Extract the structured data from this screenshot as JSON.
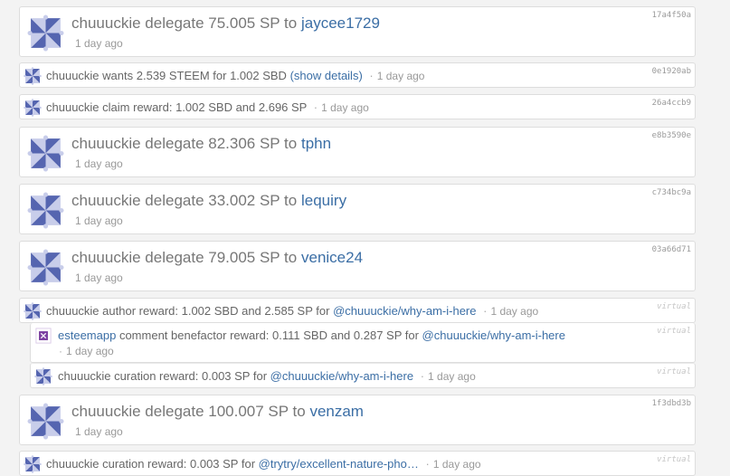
{
  "operations": [
    {
      "user": "chuuuckie",
      "text": "delegate 75.005 SP to",
      "link": "jaycee1729",
      "hash": "17a4f50a",
      "ago": "1 day ago"
    },
    {
      "user": "chuuuckie",
      "text": "wants 2.539 STEEM for 1.002 SBD",
      "link": "(show details)",
      "hash": "0e1920ab",
      "ago": "1 day ago"
    },
    {
      "user": "chuuuckie",
      "text": "claim reward: 1.002 SBD and 2.696 SP",
      "hash": "26a4ccb9",
      "ago": "1 day ago"
    },
    {
      "user": "chuuuckie",
      "text": "delegate 82.306 SP to",
      "link": "tphn",
      "hash": "e8b3590e",
      "ago": "1 day ago"
    },
    {
      "user": "chuuuckie",
      "text": "delegate 33.002 SP to",
      "link": "lequiry",
      "hash": "c734bc9a",
      "ago": "1 day ago"
    },
    {
      "user": "chuuuckie",
      "text": "delegate 79.005 SP to",
      "link": "venice24",
      "hash": "03a66d71",
      "ago": "1 day ago"
    },
    {
      "user": "chuuuckie",
      "text": "author reward: 1.002 SBD and 2.585 SP for",
      "link": "@chuuuckie/why-am-i-here",
      "hash": "virtual",
      "ago": "1 day ago"
    },
    {
      "user": "esteemapp",
      "text": "comment benefactor reward: 0.111 SBD and 0.287 SP for",
      "link": "@chuuuckie/why-am-i-here",
      "hash": "virtual",
      "ago": "1 day ago"
    },
    {
      "user": "chuuuckie",
      "text": "curation reward: 0.003 SP for",
      "link": "@chuuuckie/why-am-i-here",
      "hash": "virtual",
      "ago": "1 day ago"
    },
    {
      "user": "chuuuckie",
      "text": "delegate 100.007 SP to",
      "link": "venzam",
      "hash": "1f3dbd3b",
      "ago": "1 day ago"
    },
    {
      "user": "chuuuckie",
      "text": "curation reward: 0.003 SP for",
      "link": "@trytry/excellent-nature-pho…",
      "hash": "virtual",
      "ago": "1 day ago"
    }
  ],
  "separator": "·",
  "colors": {
    "link": "#3b6ea5",
    "avatar": "#5a6bb5",
    "esteem_avatar": "#7b3fa0"
  }
}
